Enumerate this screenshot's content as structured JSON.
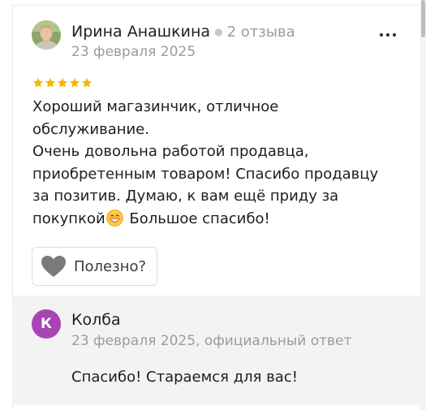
{
  "review": {
    "author_name": "Ирина Анашкина",
    "review_count": "2 отзыва",
    "date": "23 февраля 2025",
    "rating": 5,
    "rating_max": 5,
    "star_color": "#f5b800",
    "text_lines": [
      "Хороший магазинчик, отличное",
      "обслуживание.",
      "Очень довольна работой продавца,",
      "приобретенным товаром! Спасибо продавцу",
      "за позитив. Думаю, к вам ещё приду за"
    ],
    "last_line_before_emoji": "покупкой",
    "emoji_icon": "grinning-face-emoji",
    "last_line_after_emoji": " Большое спасибо!",
    "more_icon": "ellipsis-icon",
    "helpful_button": {
      "label": "Полезно?",
      "icon": "heart-icon"
    }
  },
  "reply": {
    "avatar_letter": "К",
    "avatar_color": "#a844b4",
    "name": "Колба",
    "meta": "23 февраля 2025, официальный ответ",
    "text": "Спасибо! Стараемся для вас!"
  }
}
